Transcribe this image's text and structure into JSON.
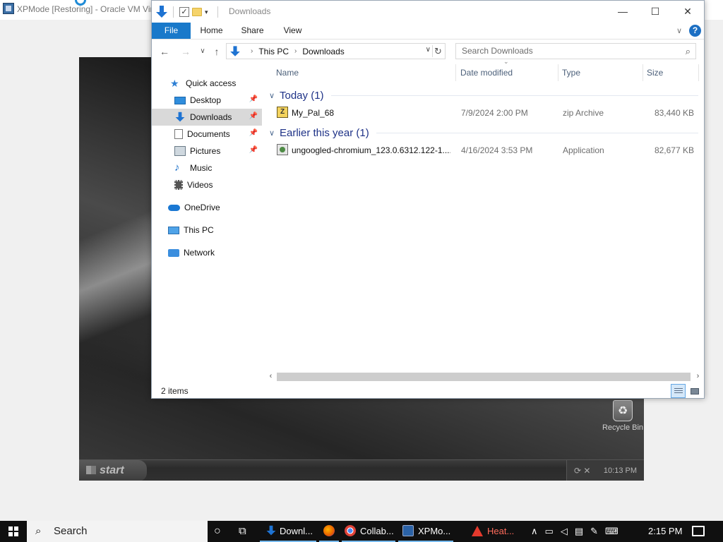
{
  "vbox": {
    "title": "XPMode [Restoring] - Oracle VM Vir"
  },
  "xp": {
    "recycle_label": "Recycle Bin",
    "start_label": "start",
    "clock": "10:13 PM"
  },
  "explorer": {
    "title": "Downloads",
    "ribbon_tabs": [
      "File",
      "Home",
      "Share",
      "View"
    ],
    "breadcrumb": [
      "This PC",
      "Downloads"
    ],
    "search_placeholder": "Search Downloads",
    "nav": [
      {
        "label": "Quick access",
        "icon": "star-icon"
      },
      {
        "label": "Desktop",
        "icon": "desktop-icon",
        "pinned": true
      },
      {
        "label": "Downloads",
        "icon": "downloads-icon",
        "pinned": true,
        "selected": true
      },
      {
        "label": "Documents",
        "icon": "documents-icon",
        "pinned": true
      },
      {
        "label": "Pictures",
        "icon": "pictures-icon",
        "pinned": true
      },
      {
        "label": "Music",
        "icon": "music-icon"
      },
      {
        "label": "Videos",
        "icon": "videos-icon"
      },
      {
        "label": "OneDrive",
        "icon": "cloud-icon"
      },
      {
        "label": "This PC",
        "icon": "computer-icon"
      },
      {
        "label": "Network",
        "icon": "network-icon"
      }
    ],
    "columns": [
      "Name",
      "Date modified",
      "Type",
      "Size"
    ],
    "groups": [
      {
        "title": "Today (1)",
        "files": [
          {
            "name": "My_Pal_68",
            "date": "7/9/2024 2:00 PM",
            "type": "zip Archive",
            "size": "83,440 KB",
            "icon": "zip-archive-icon"
          }
        ]
      },
      {
        "title": "Earlier this year (1)",
        "files": [
          {
            "name": "ungoogled-chromium_123.0.6312.122-1....",
            "date": "4/16/2024 3:53 PM",
            "type": "Application",
            "size": "82,677 KB",
            "icon": "application-icon"
          }
        ]
      }
    ],
    "status": "2 items"
  },
  "taskbar": {
    "search_label": "Search",
    "items": [
      {
        "label": "Downl...",
        "icon": "downloads-icon"
      },
      {
        "label": "",
        "icon": "firefox-icon"
      },
      {
        "label": "Collab...",
        "icon": "chrome-icon"
      },
      {
        "label": "XPMo...",
        "icon": "virtualbox-icon"
      },
      {
        "label": "Heat...",
        "icon": "warning-icon"
      }
    ],
    "clock": "2:15 PM"
  }
}
